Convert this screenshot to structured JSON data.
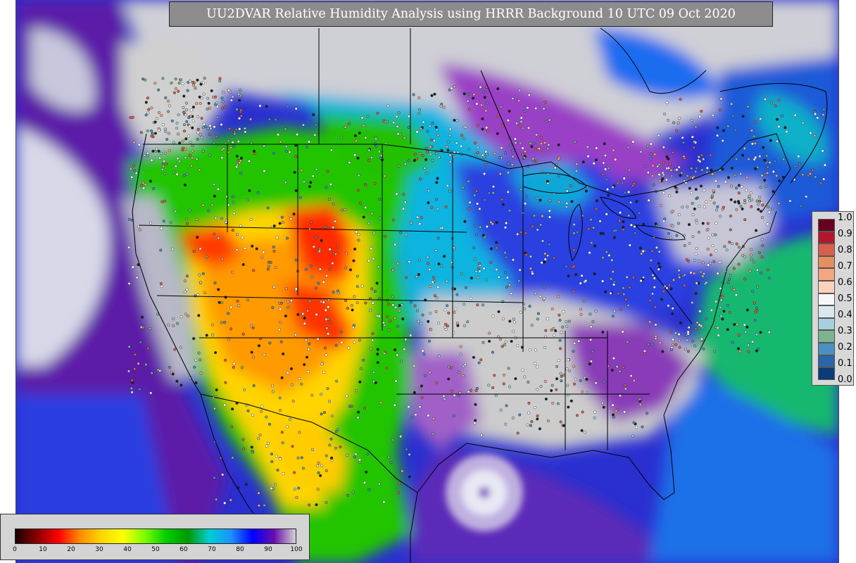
{
  "title": "UU2DVAR Relative Humidity Analysis using HRRR Background 10 UTC 09 Oct 2020",
  "obs_legend": {
    "labels": [
      "1.0",
      "0.9",
      "0.8",
      "0.7",
      "0.6",
      "0.5",
      "0.4",
      "0.3",
      "0.2",
      "0.1",
      "0.0"
    ],
    "colors": [
      "#67001f",
      "#b2182b",
      "#d6604d",
      "#e08a5a",
      "#f4a582",
      "#fddbc7",
      "#f7f7f7",
      "#d1e5f0",
      "#92c5de",
      "#7cb490",
      "#4393c3",
      "#2166ac",
      "#053061"
    ]
  },
  "rh_colorbar": {
    "ticks": [
      "0",
      "10",
      "20",
      "30",
      "40",
      "50",
      "60",
      "70",
      "80",
      "90",
      "100"
    ],
    "stops": [
      "#1a0000",
      "#8b0000",
      "#ff0000",
      "#ff8c00",
      "#ffd700",
      "#ffff00",
      "#7cfc00",
      "#00cd00",
      "#009900",
      "#00ced1",
      "#1e90ff",
      "#0000ff",
      "#6a0dad",
      "#d3d3d3"
    ]
  },
  "map": {
    "colors": {
      "ocean_moist": "#5a1aa6",
      "ocean_blue": "#1a3fe0",
      "gray_saturated": "#d0d0d0",
      "green": "#00c800",
      "yellow": "#ffd000",
      "orange": "#ff8c00",
      "red": "#ff1a00",
      "cyan": "#00b4d8",
      "teal": "#00a08c",
      "boundary": "#000000"
    }
  }
}
